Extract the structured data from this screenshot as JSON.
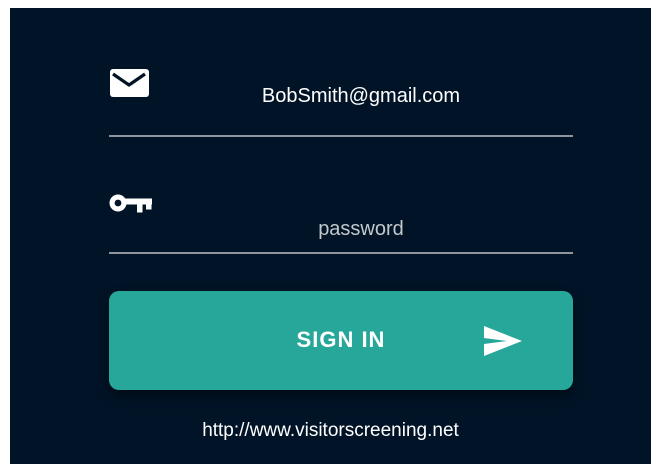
{
  "login": {
    "email": {
      "icon": "mail-icon",
      "value": "BobSmith@gmail.com"
    },
    "password": {
      "icon": "key-icon",
      "placeholder": "password",
      "value": ""
    },
    "signin_button": {
      "label": "SIGN IN",
      "icon": "send-icon"
    }
  },
  "footer": {
    "link_text": "http://www.visitorscreening.net"
  },
  "colors": {
    "background": "#011427",
    "accent": "#27a69a",
    "underline": "#8e959c",
    "text": "#ffffff"
  }
}
